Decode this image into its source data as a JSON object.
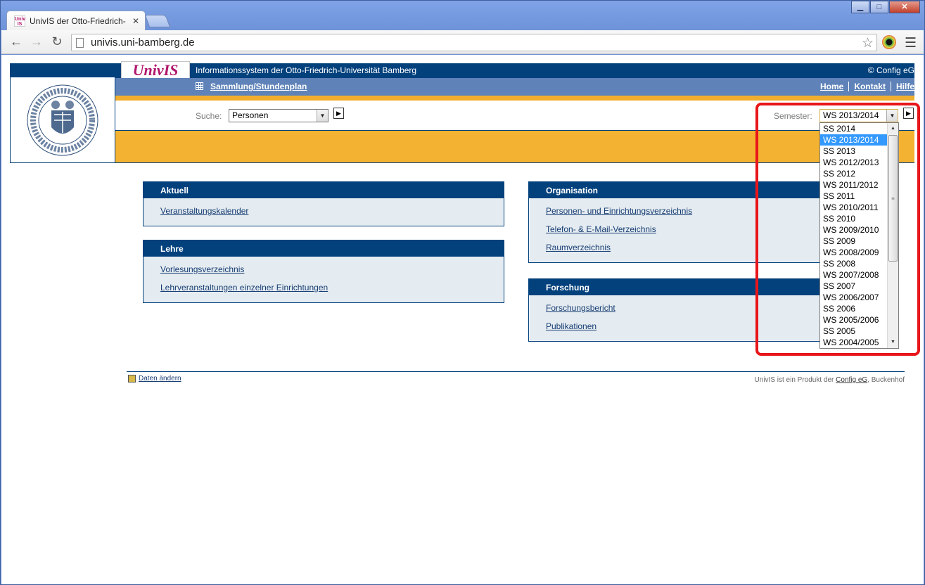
{
  "browser": {
    "tab_title": "UnivIS der Otto-Friedrich-",
    "tab_favicon": "Univ IS",
    "url": "univis.uni-bamberg.de",
    "window_controls": {
      "minimize": "▁",
      "maximize": "□",
      "close": "✕"
    }
  },
  "header": {
    "logo_text": "UnivIS",
    "system_title": "Informationssystem der Otto-Friedrich-Universität Bamberg",
    "copyright": "© Config eG",
    "nav_main": "Sammlung/Stundenplan",
    "nav_links": [
      "Home",
      "Kontakt",
      "Hilfe"
    ]
  },
  "search": {
    "label": "Suche:",
    "selected": "Personen",
    "semester_label": "Semester:",
    "semester_selected": "WS 2013/2014"
  },
  "semester_options": [
    "SS 2014",
    "WS 2013/2014",
    "SS 2013",
    "WS 2012/2013",
    "SS 2012",
    "WS 2011/2012",
    "SS 2011",
    "WS 2010/2011",
    "SS 2010",
    "WS 2009/2010",
    "SS 2009",
    "WS 2008/2009",
    "SS 2008",
    "WS 2007/2008",
    "SS 2007",
    "WS 2006/2007",
    "SS 2006",
    "WS 2005/2006",
    "SS 2005",
    "WS 2004/2005"
  ],
  "semester_selected_index": 1,
  "boxes": {
    "aktuell": {
      "title": "Aktuell",
      "links": [
        "Veranstaltungskalender"
      ]
    },
    "lehre": {
      "title": "Lehre",
      "links": [
        "Vorlesungsverzeichnis",
        "Lehrveranstaltungen einzelner Einrichtungen"
      ]
    },
    "organisation": {
      "title": "Organisation",
      "links": [
        "Personen- und Einrichtungsverzeichnis",
        "Telefon- & E-Mail-Verzeichnis",
        "Raumverzeichnis"
      ]
    },
    "forschung": {
      "title": "Forschung",
      "links": [
        "Forschungsbericht",
        "Publikationen"
      ]
    }
  },
  "footer": {
    "left_link": "Daten ändern",
    "right_text": "UnivIS ist ein Produkt der",
    "right_link": "Config eG",
    "right_suffix": ", Buckenhof"
  },
  "colors": {
    "primary": "#03417d",
    "accent": "#f3b231",
    "nav": "#5f83b9",
    "brand": "#b0156b",
    "highlight": "#e8161a"
  }
}
